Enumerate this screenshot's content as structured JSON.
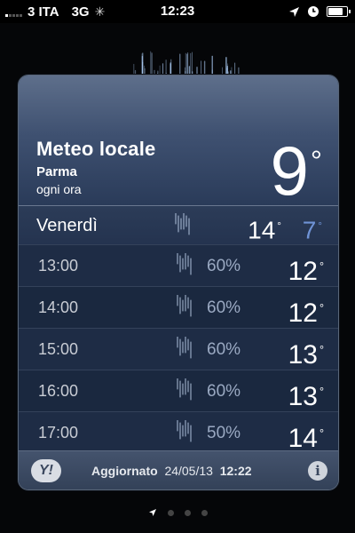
{
  "status_bar": {
    "carrier": "3 ITA",
    "network": "3G",
    "time": "12:23",
    "signal_bars_active": 1,
    "battery_level": 0.85,
    "icons": [
      "signal-bars-icon",
      "activity-spinner-icon",
      "location-arrow-icon",
      "alarm-clock-icon",
      "battery-icon"
    ]
  },
  "weather": {
    "title": "Meteo locale",
    "city": "Parma",
    "mode": "ogni ora",
    "current_temp": "9",
    "degree_symbol": "°",
    "day": {
      "name": "Venerdì",
      "high": "14",
      "low": "7",
      "icon": "rain-icon"
    },
    "hours": [
      {
        "time": "13:00",
        "precip": "60%",
        "temp": "12",
        "icon": "rain-icon"
      },
      {
        "time": "14:00",
        "precip": "60%",
        "temp": "12",
        "icon": "rain-icon"
      },
      {
        "time": "15:00",
        "precip": "60%",
        "temp": "13",
        "icon": "rain-icon"
      },
      {
        "time": "16:00",
        "precip": "60%",
        "temp": "13",
        "icon": "rain-icon"
      },
      {
        "time": "17:00",
        "precip": "50%",
        "temp": "14",
        "icon": "rain-icon"
      }
    ],
    "footer": {
      "label": "Aggiornato",
      "date": "24/05/13",
      "time": "12:22",
      "logo": "Y!"
    }
  },
  "pager": {
    "pages": 4,
    "current": 0
  },
  "colors": {
    "background": "#050608",
    "card": "#1b2a44",
    "header_top": "#5e6f8b",
    "low_temp": "#6f93d6",
    "precip_text": "#9aa9c2"
  }
}
